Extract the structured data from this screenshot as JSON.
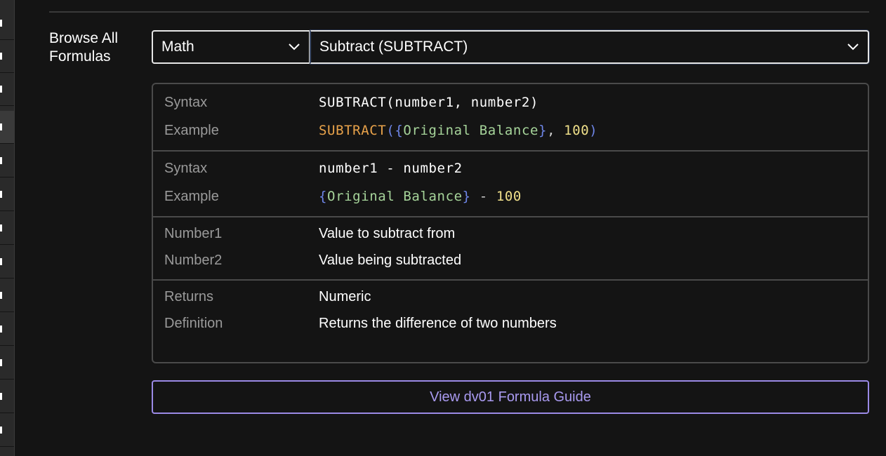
{
  "browse": {
    "label": "Browse All Formulas"
  },
  "category_select": {
    "value": "Math"
  },
  "formula_select": {
    "value": "Subtract (SUBTRACT)"
  },
  "function_form": {
    "syntax_label": "Syntax",
    "syntax": "SUBTRACT(number1, number2)",
    "example_label": "Example",
    "example_tokens": {
      "fn": "SUBTRACT",
      "open_paren": "(",
      "open_brace": "{",
      "field": "Original Balance",
      "close_brace": "}",
      "comma": ", ",
      "num": "100",
      "close_paren": ")"
    }
  },
  "operator_form": {
    "syntax_label": "Syntax",
    "syntax": "number1 - number2",
    "example_label": "Example",
    "example_tokens": {
      "open_brace": "{",
      "field": "Original Balance",
      "close_brace": "}",
      "op": " - ",
      "num": "100"
    }
  },
  "params": [
    {
      "name": "Number1",
      "desc": "Value to subtract from"
    },
    {
      "name": "Number2",
      "desc": "Value being subtracted"
    }
  ],
  "meta": {
    "returns_label": "Returns",
    "returns": "Numeric",
    "definition_label": "Definition",
    "definition": "Returns the difference of two numbers"
  },
  "guide_button": {
    "label": "View dv01 Formula Guide"
  },
  "colors": {
    "accent": "#9b8ae6",
    "function_token": "#e8a24a",
    "field_token": "#a6d49a",
    "number_token": "#f0e08a",
    "brace_token": "#6e86e8"
  }
}
